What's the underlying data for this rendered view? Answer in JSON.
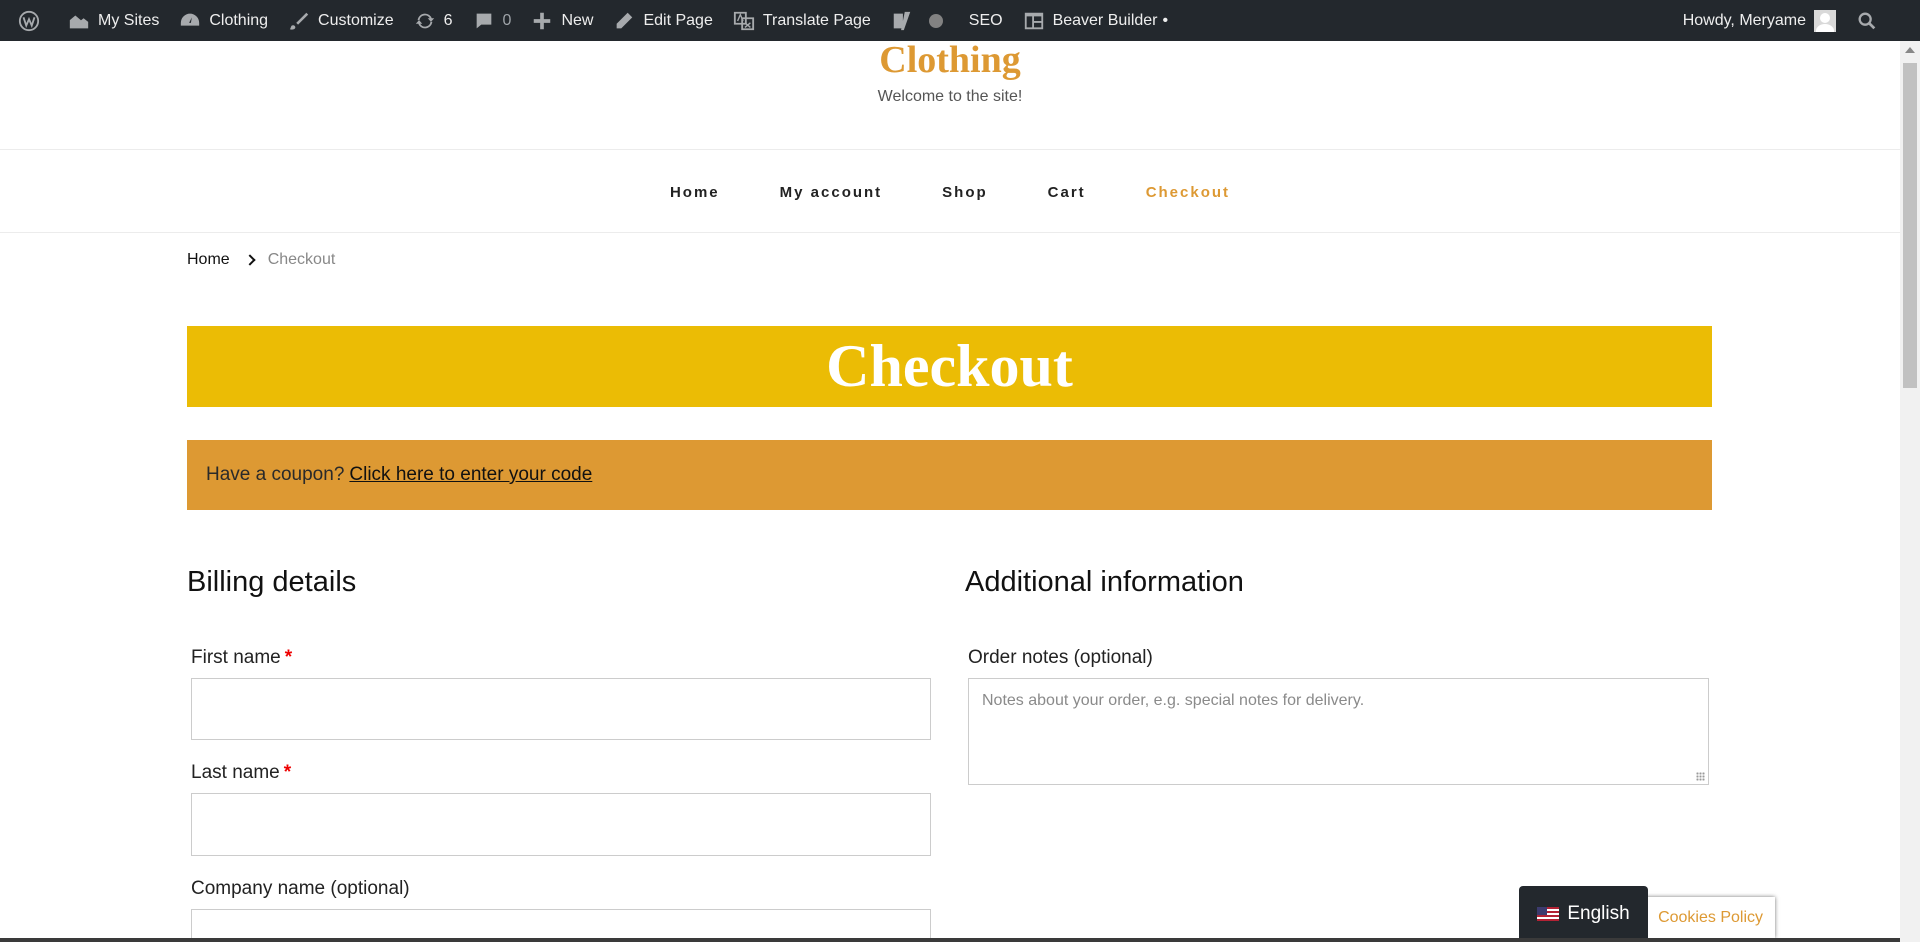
{
  "adminbar": {
    "my_sites": "My Sites",
    "site_name": "Clothing",
    "customize": "Customize",
    "updates_count": "6",
    "comments_count": "0",
    "new_label": "New",
    "edit_page": "Edit Page",
    "translate_page": "Translate Page",
    "seo": "SEO",
    "beaver_builder": "Beaver Builder",
    "beaver_builder_dot": "•",
    "howdy": "Howdy, Meryame"
  },
  "site": {
    "title": "Clothing",
    "tagline": "Welcome to the site!"
  },
  "nav": {
    "items": [
      {
        "label": "Home"
      },
      {
        "label": "My account"
      },
      {
        "label": "Shop"
      },
      {
        "label": "Cart"
      },
      {
        "label": "Checkout",
        "active": true
      }
    ]
  },
  "breadcrumb": {
    "home": "Home",
    "current": "Checkout"
  },
  "page": {
    "heading": "Checkout"
  },
  "coupon": {
    "prompt": "Have a coupon?",
    "link": "Click here to enter your code"
  },
  "billing": {
    "title": "Billing details",
    "first_name_label": "First name",
    "last_name_label": "Last name",
    "company_label": "Company name (optional)",
    "required_marker": "*"
  },
  "additional": {
    "title": "Additional information",
    "notes_label": "Order notes (optional)",
    "notes_placeholder": "Notes about your order, e.g. special notes for delivery."
  },
  "footer_widgets": {
    "language": "English",
    "cookies": "Cookies Policy"
  },
  "colors": {
    "accent": "#dd9933",
    "banner": "#ebbc05",
    "adminbar": "#23282d"
  }
}
